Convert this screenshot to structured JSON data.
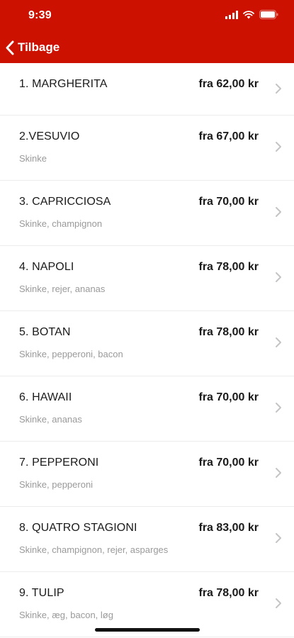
{
  "status_bar": {
    "time": "9:39",
    "icons": [
      "signal-icon",
      "wifi-icon",
      "battery-icon"
    ]
  },
  "nav": {
    "back_label": "Tilbage",
    "back_icon": "chevron-left-icon",
    "header_color": "#cc1100"
  },
  "menu": {
    "items": [
      {
        "name": "1. MARGHERITA",
        "description": "",
        "price": "fra 62,00 kr"
      },
      {
        "name": "2.VESUVIO",
        "description": "Skinke",
        "price": "fra 67,00 kr"
      },
      {
        "name": "3. CAPRICCIOSA",
        "description": "Skinke, champignon",
        "price": "fra 70,00 kr"
      },
      {
        "name": "4. NAPOLI",
        "description": "Skinke, rejer, ananas",
        "price": "fra 78,00 kr"
      },
      {
        "name": "5. BOTAN",
        "description": "Skinke, pepperoni, bacon",
        "price": "fra 78,00 kr"
      },
      {
        "name": "6. HAWAII",
        "description": "Skinke, ananas",
        "price": "fra 70,00 kr"
      },
      {
        "name": "7. PEPPERONI",
        "description": "Skinke, pepperoni",
        "price": "fra 70,00 kr"
      },
      {
        "name": "8. QUATRO STAGIONI",
        "description": "Skinke, champignon, rejer, asparges",
        "price": "fra 83,00 kr"
      },
      {
        "name": "9. TULIP",
        "description": "Skinke, æg, bacon, løg",
        "price": "fra 78,00 kr"
      }
    ]
  }
}
